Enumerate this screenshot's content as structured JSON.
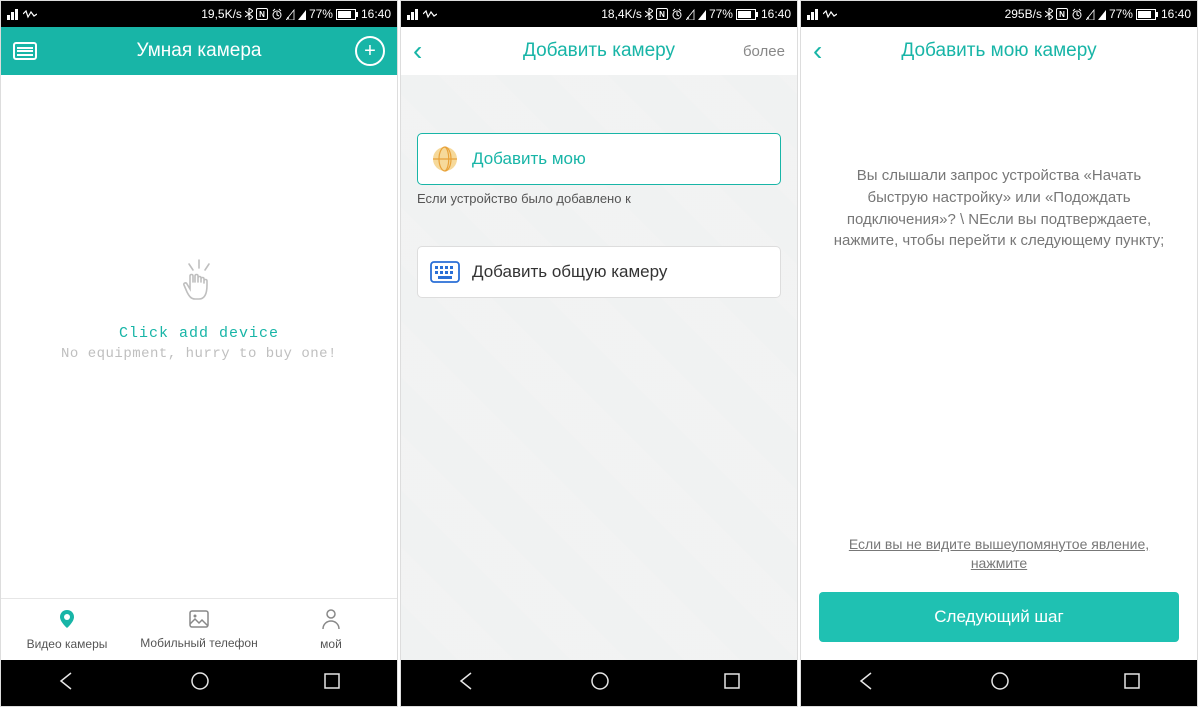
{
  "status": {
    "speed1": "19,5K/s",
    "speed2": "18,4K/s",
    "speed3": "295B/s",
    "battery": "77%",
    "time": "16:40"
  },
  "screen1": {
    "title": "Умная камера",
    "empty_title": "Click add device",
    "empty_sub": "No equipment, hurry to buy one!",
    "tabs": {
      "video": "Видео камеры",
      "phone": "Мобильный телефон",
      "my": "мой"
    }
  },
  "screen2": {
    "title": "Добавить камеру",
    "more": "более",
    "opt1": "Добавить мою",
    "opt1_sub": "Если устройство было добавлено к",
    "opt2": "Добавить общую камеру"
  },
  "screen3": {
    "title": "Добавить мою камеру",
    "instr": "Вы слышали запрос устройства «Начать быструю настройку» или «Подождать подключения»? \\ NЕсли вы подтверждаете, нажмите, чтобы перейти к следующему пункту;",
    "link": "Если вы не видите вышеупомянутое явление, нажмите",
    "next": "Следующий шаг"
  }
}
